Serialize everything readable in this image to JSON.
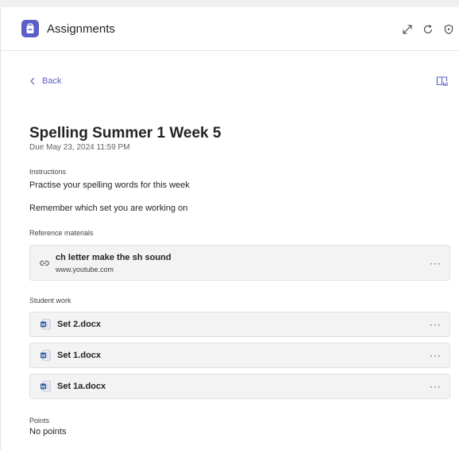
{
  "header": {
    "app_title": "Assignments",
    "app_icon": "backpack-icon",
    "accent": "#5b5fc7",
    "actions": [
      "expand-icon",
      "refresh-icon",
      "shield-icon"
    ]
  },
  "nav": {
    "back_label": "Back",
    "reading_icon": "immersive-reader-icon"
  },
  "assignment": {
    "title": "Spelling Summer 1 Week 5",
    "due": "Due May 23, 2024 11:59 PM"
  },
  "instructions": {
    "label": "Instructions",
    "lines": [
      "Practise your spelling words for this week",
      "Remember which set you are working on"
    ]
  },
  "reference": {
    "label": "Reference materials",
    "items": [
      {
        "title": "ch letter make the sh sound",
        "url": "www.youtube.com",
        "icon": "link-icon",
        "more": "···"
      }
    ]
  },
  "student_work": {
    "label": "Student work",
    "items": [
      {
        "name": "Set 2.docx",
        "icon": "word-doc-icon",
        "more": "···"
      },
      {
        "name": "Set 1.docx",
        "icon": "word-doc-icon",
        "more": "···"
      },
      {
        "name": "Set 1a.docx",
        "icon": "word-doc-icon",
        "more": "···"
      }
    ]
  },
  "points": {
    "label": "Points",
    "value": "No points"
  }
}
